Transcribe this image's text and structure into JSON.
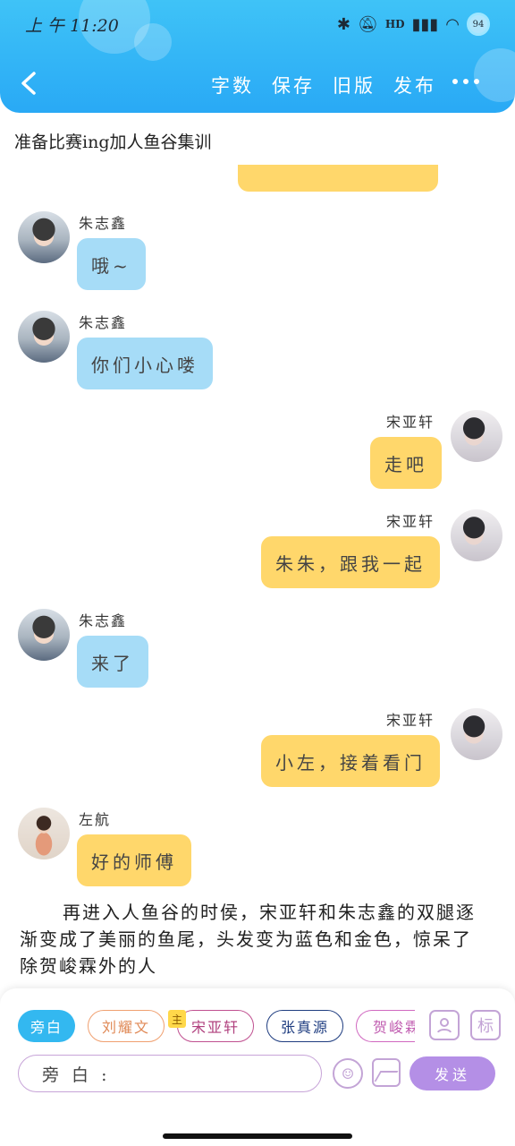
{
  "status_bar": {
    "time": "上 午 11:20",
    "battery": "94",
    "signal": "HD"
  },
  "header": {
    "actions": [
      "字数",
      "保存",
      "旧版",
      "发布"
    ]
  },
  "chapter_title": "准备比赛ing加人鱼谷集训",
  "messages": [
    {
      "name": "朱志鑫",
      "text": "哦~",
      "side": "left",
      "avatar": "zhu"
    },
    {
      "name": "朱志鑫",
      "text": "你们小心喽",
      "side": "left",
      "avatar": "zhu"
    },
    {
      "name": "宋亚轩",
      "text": "走吧",
      "side": "right",
      "avatar": "song"
    },
    {
      "name": "宋亚轩",
      "text": "朱朱，跟我一起",
      "side": "right",
      "avatar": "song"
    },
    {
      "name": "朱志鑫",
      "text": "来了",
      "side": "left",
      "avatar": "zhu"
    },
    {
      "name": "宋亚轩",
      "text": "小左，接着看门",
      "side": "right",
      "avatar": "song"
    },
    {
      "name": "左航",
      "text": "好的师傅",
      "side": "left",
      "avatar": "zuo"
    }
  ],
  "narration": "再进入人鱼谷的时侯，宋亚轩和朱志鑫的双腿逐渐变成了美丽的鱼尾，头发变为蓝色和金色，惊呆了除贺峻霖外的人",
  "composer": {
    "roles": [
      "旁白",
      "刘耀文",
      "宋亚轩",
      "张真源",
      "贺峻霖"
    ],
    "main_tag": "主",
    "input_value": "旁 白 :",
    "send_label": "发送",
    "tag_label": "标"
  }
}
